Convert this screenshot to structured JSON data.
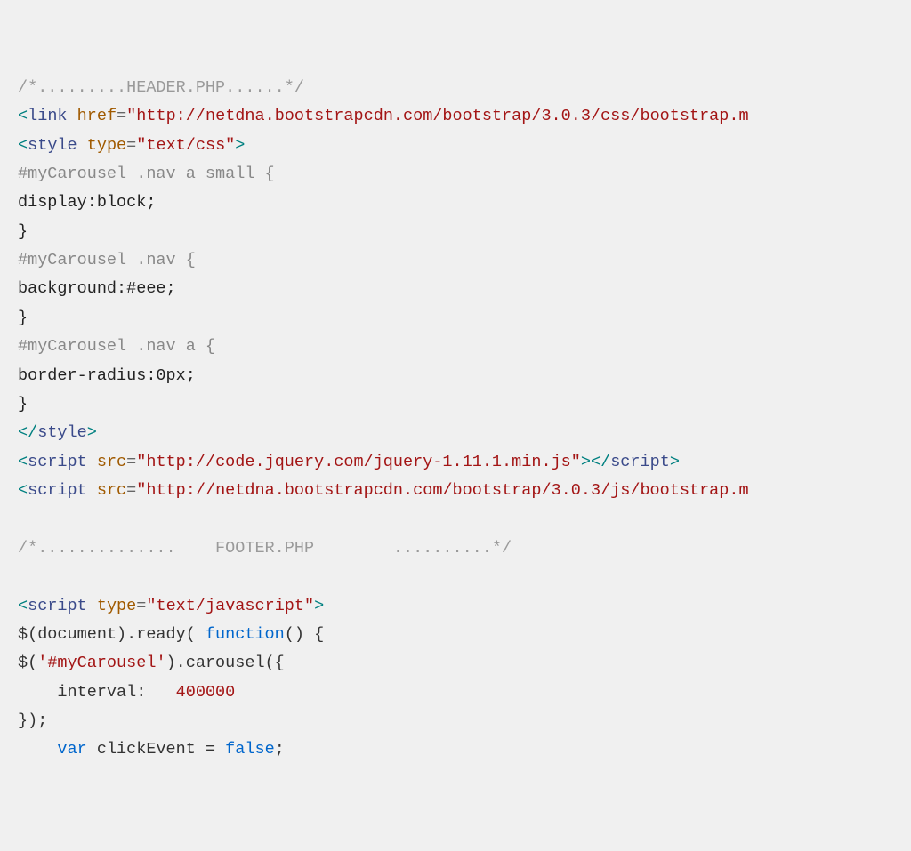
{
  "lines": {
    "l1_comment": "/*.........HEADER.PHP......*/",
    "l2_open": "<",
    "l2_tag": "link",
    "l2_sp": " ",
    "l2_attr": "href",
    "l2_eq": "=",
    "l2_val": "\"http://netdna.bootstrapcdn.com/bootstrap/3.0.3/css/bootstrap.m",
    "l3_open": "<",
    "l3_tag": "style",
    "l3_sp": " ",
    "l3_attr": "type",
    "l3_eq": "=",
    "l3_val": "\"text/css\"",
    "l3_close": ">",
    "l4_sel": "#myCarousel .nav a small {",
    "l5_css": "display:block;",
    "l6_css": "}",
    "l7_sel": "#myCarousel .nav {",
    "l8_css": "background:#eee;",
    "l9_css": "}",
    "l10_sel": "#myCarousel .nav a {",
    "l11_css": "border-radius:0px;",
    "l12_css": "}",
    "l13_open": "</",
    "l13_tag": "style",
    "l13_close": ">",
    "l14_open": "<",
    "l14_tag": "script",
    "l14_sp": " ",
    "l14_attr": "src",
    "l14_eq": "=",
    "l14_val": "\"http://code.jquery.com/jquery-1.11.1.min.js\"",
    "l14_close": ">",
    "l14_open2": "</",
    "l14_tag2": "script",
    "l14_close2": ">",
    "l15_open": "<",
    "l15_tag": "script",
    "l15_sp": " ",
    "l15_attr": "src",
    "l15_eq": "=",
    "l15_val": "\"http://netdna.bootstrapcdn.com/bootstrap/3.0.3/js/bootstrap.m",
    "blank1": "",
    "l17_comment": "/*..............    FOOTER.PHP        ..........*/",
    "blank2": "",
    "l19_open": "<",
    "l19_tag": "script",
    "l19_sp": " ",
    "l19_attr": "type",
    "l19_eq": "=",
    "l19_val": "\"text/javascript\"",
    "l19_close": ">",
    "l20_a": "$(document).ready( ",
    "l20_kw": "function",
    "l20_b": "() {",
    "l21_a": "$(",
    "l21_str": "'#myCarousel'",
    "l21_b": ").carousel({",
    "l22_a": "    interval:   ",
    "l22_num": "400000",
    "l23": "});",
    "l24_a": "    ",
    "l24_kw": "var",
    "l24_b": " clickEvent = ",
    "l24_bool": "false",
    "l24_c": ";"
  }
}
